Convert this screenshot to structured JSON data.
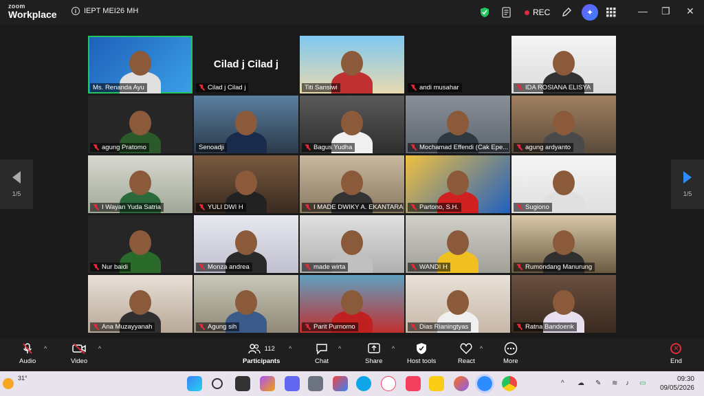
{
  "app": {
    "brand_top": "zoom",
    "brand_bottom": "Workplace",
    "meeting_title": "IEPT MEI26 MH",
    "rec_label": "REC"
  },
  "pager": {
    "left": "1/5",
    "right": "1/5"
  },
  "participants": [
    {
      "name": "Ms. Renanda Ayu",
      "muted": false,
      "active": true
    },
    {
      "name": "Cilad j Cilad j",
      "muted": true,
      "no_video": true
    },
    {
      "name": "Titi Sansiwi",
      "muted": false
    },
    {
      "name": "andi musahar",
      "muted": true,
      "no_video": true
    },
    {
      "name": "IDA ROSIANA ELISYA",
      "muted": true
    },
    {
      "name": "agung Pratomo",
      "muted": true
    },
    {
      "name": "Senoadji",
      "muted": false
    },
    {
      "name": "Bagus Yudha",
      "muted": true
    },
    {
      "name": "Mochamad Effendi (Cak Epe...",
      "muted": true
    },
    {
      "name": "agung ardyanto",
      "muted": true
    },
    {
      "name": "I Wayan Yuda Satria",
      "muted": true
    },
    {
      "name": "YULI DWI H",
      "muted": true
    },
    {
      "name": "I MADE DWIKY A. EKANTARA",
      "muted": true
    },
    {
      "name": "Partono, S.H.",
      "muted": true
    },
    {
      "name": "Sugiono",
      "muted": true
    },
    {
      "name": "Nur baidi",
      "muted": true
    },
    {
      "name": "Monza andrea",
      "muted": true
    },
    {
      "name": "made wirta",
      "muted": true
    },
    {
      "name": "WANDI H",
      "muted": true
    },
    {
      "name": "Rumondang Manurung",
      "muted": true
    },
    {
      "name": "Ana Muzayyanah",
      "muted": true
    },
    {
      "name": "Agung sih",
      "muted": true
    },
    {
      "name": "Parit Purnomo",
      "muted": true
    },
    {
      "name": "Dias Rianingtyas",
      "muted": true
    },
    {
      "name": "Ratna Bandoenk",
      "muted": true
    }
  ],
  "toolbar": {
    "audio": "Audio",
    "video": "Video",
    "participants": "Participants",
    "participants_count": "112",
    "chat": "Chat",
    "share": "Share",
    "host_tools": "Host tools",
    "react": "React",
    "more": "More",
    "end": "End"
  },
  "taskbar": {
    "temp": "31°",
    "time": "09:30",
    "date": "09/05/2026"
  },
  "colors": {
    "active_speaker": "#22c55e",
    "mute": "#e02b3c",
    "accent": "#2d8cff"
  }
}
